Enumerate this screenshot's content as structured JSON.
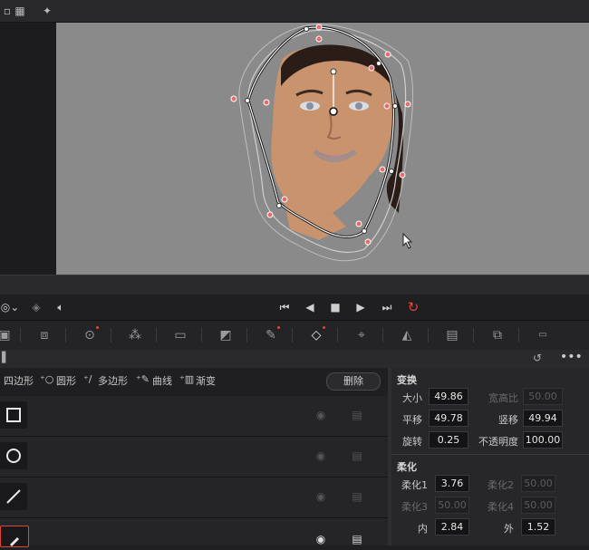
{
  "transport": {
    "skip_back": "⏮",
    "prev": "◀",
    "stop": "■",
    "play": "▶",
    "skip_fwd": "⏭",
    "loop": "↻"
  },
  "shapes": {
    "quad": "四边形",
    "circle": "圆形",
    "polygon": "多边形",
    "curve": "曲线",
    "gradient": "渐变",
    "delete": "删除"
  },
  "inspector": {
    "transform": {
      "title": "变换",
      "size_label": "大小",
      "size": "49.86",
      "aspect_label": "宽高比",
      "aspect": "50.00",
      "pan_label": "平移",
      "pan": "49.78",
      "tilt_label": "竖移",
      "tilt": "49.94",
      "rotate_label": "旋转",
      "rotate": "0.25",
      "opacity_label": "不透明度",
      "opacity": "100.00"
    },
    "soften": {
      "title": "柔化",
      "s1_label": "柔化1",
      "s1": "3.76",
      "s2_label": "柔化2",
      "s2": "50.00",
      "s3_label": "柔化3",
      "s3": "50.00",
      "s4_label": "柔化4",
      "s4": "50.00",
      "inside_label": "内",
      "inside": "2.84",
      "outside_label": "外",
      "outside": "1.52"
    }
  },
  "colors": {
    "loop_active": "#e0453a",
    "viewer_bg": "#8a8a8a",
    "curve_point": "#e86a6a"
  }
}
